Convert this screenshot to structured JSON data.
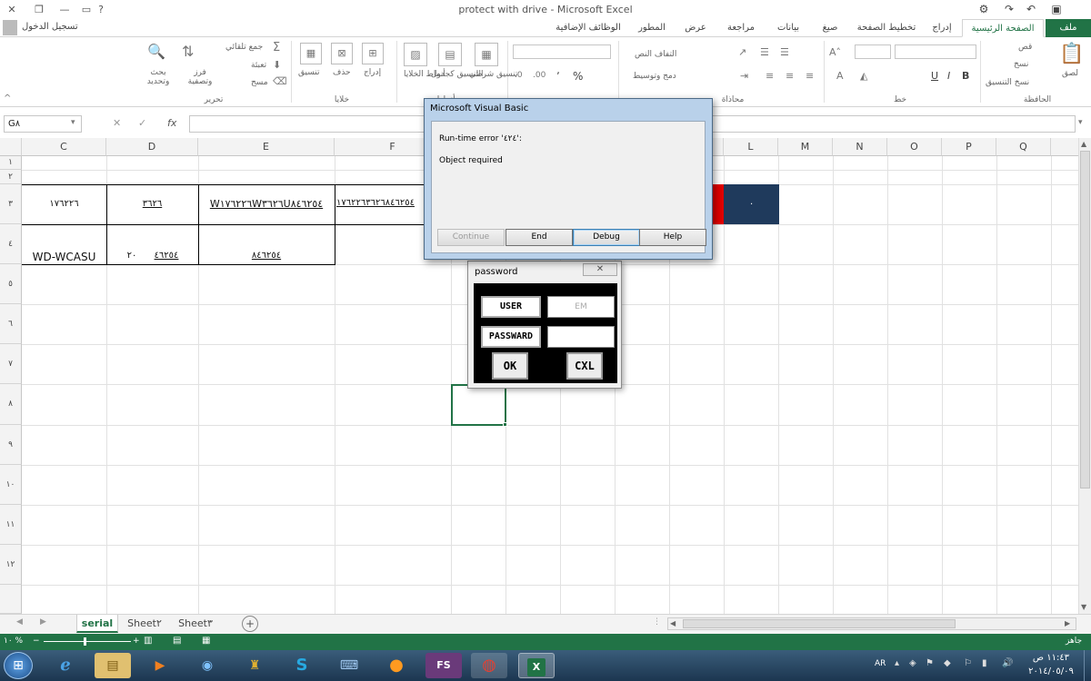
{
  "window": {
    "title": "protect with drive - Microsoft Excel",
    "sign_in": "تسجيل الدخول",
    "help": "?"
  },
  "ribbon_tabs": [
    "ملف",
    "الصفحة الرئيسية",
    "إدراج",
    "تخطيط الصفحة",
    "صيغ",
    "بيانات",
    "مراجعة",
    "عرض",
    "المطور",
    "الوظائف الإضافية"
  ],
  "ribbon": {
    "clipboard": {
      "paste": "لصق",
      "cut": "قص",
      "copy": "نسخ",
      "format_painter": "نسخ التنسيق",
      "group": "الحافظة"
    },
    "font": {
      "group": "خط",
      "bold": "B",
      "italic": "I",
      "underline": "U"
    },
    "alignment": {
      "wrap": "التفاف النص",
      "merge": "دمج وتوسيط",
      "group": "محاذاة"
    },
    "number": {
      "percent": "%",
      "comma": "٬"
    },
    "styles": {
      "conditional": "تنسيق شرطي",
      "as_table": "التنسيق كجدول",
      "cell_styles": "أنماط الخلايا",
      "group": "أنماط"
    },
    "cells": {
      "insert": "إدراج",
      "delete": "حذف",
      "format": "تنسيق",
      "group": "خلايا"
    },
    "editing": {
      "autosum": "جمع تلقائي",
      "fill": "تعبئة",
      "clear": "مسح",
      "sort": "فرز وتصفية",
      "find": "بحث وتحديد",
      "group": "تحرير"
    }
  },
  "formula_bar": {
    "name_box": "G٨",
    "fx": "fx",
    "cancel": "✕",
    "enter": "✓"
  },
  "grid": {
    "columns": [
      "C",
      "D",
      "E",
      "F",
      "G",
      "H",
      "I",
      "J",
      "K",
      "L",
      "M",
      "N",
      "O",
      "P",
      "Q"
    ],
    "rows": [
      "١",
      "٢",
      "٣",
      "٤",
      "٥",
      "٦",
      "٧",
      "٨",
      "٩",
      "١٠",
      "١١",
      "١٢"
    ],
    "cells": {
      "c3": "١٧٦٢٢٦",
      "d3": "٣٦٢٦",
      "e3": "W١٧٦٢٢٦W٣٦٢٦U٨٤٦٢٥٤",
      "f3": "١٧٦٢٢٦٣٦٢٦٨٤٦٢٥٤",
      "l3": "٠",
      "c4": "WD-WCASU",
      "d4_a": "٢٠",
      "d4_b": "٤٦٢٥٤",
      "e4": "٨٤٦٢٥٤"
    }
  },
  "vba_dialog": {
    "title": "Microsoft Visual Basic",
    "error": "Run-time error '٤٢٤':",
    "message": "Object required",
    "buttons": {
      "continue": "Continue",
      "end": "End",
      "debug": "Debug",
      "help": "Help"
    }
  },
  "userform": {
    "title": "password",
    "user_label": "USER",
    "user_value": "EM",
    "password_label": "PASSWARD",
    "ok": "OK",
    "cancel": "CXL"
  },
  "sheets": [
    "serial",
    "Sheet٢",
    "Sheet٣"
  ],
  "status": {
    "ready": "جاهز",
    "zoom": "١٠ %"
  },
  "taskbar": {
    "time": "١١:٤٣ ص",
    "date": "٢٠١٤/٠٥/٠٩",
    "lang": "AR",
    "fs": "FS"
  },
  "colors": {
    "excel_green": "#217346",
    "red_cell": "#e00000",
    "navy_cell": "#1f3a5c"
  }
}
